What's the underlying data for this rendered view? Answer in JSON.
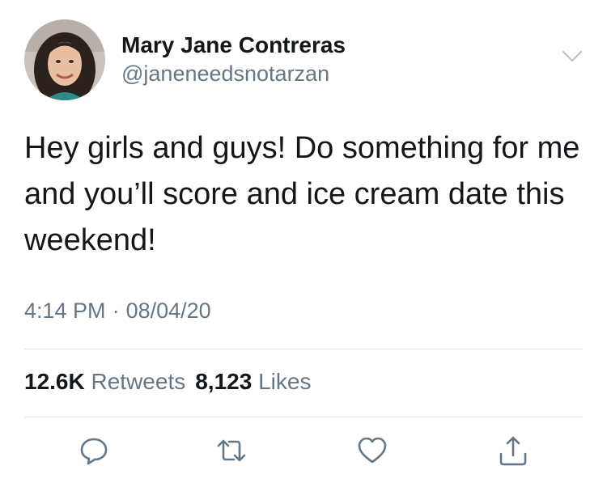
{
  "user": {
    "display_name": "Mary Jane Contreras",
    "handle": "@janeneedsnotarzan"
  },
  "tweet": {
    "text": "Hey girls and guys! Do something for me and you’ll score and ice cream date this weekend!",
    "time": "4:14 PM",
    "separator": "·",
    "date": "08/04/20"
  },
  "stats": {
    "retweets_count": "12.6K",
    "retweets_label": "Retweets",
    "likes_count": "8,123",
    "likes_label": "Likes"
  },
  "icons": {
    "more": "chevron-down-icon",
    "reply": "reply-icon",
    "retweet": "retweet-icon",
    "like": "heart-icon",
    "share": "share-icon"
  },
  "colors": {
    "text": "#14171a",
    "secondary": "#657786",
    "divider": "#e1e8ed",
    "icon": "#657786"
  }
}
